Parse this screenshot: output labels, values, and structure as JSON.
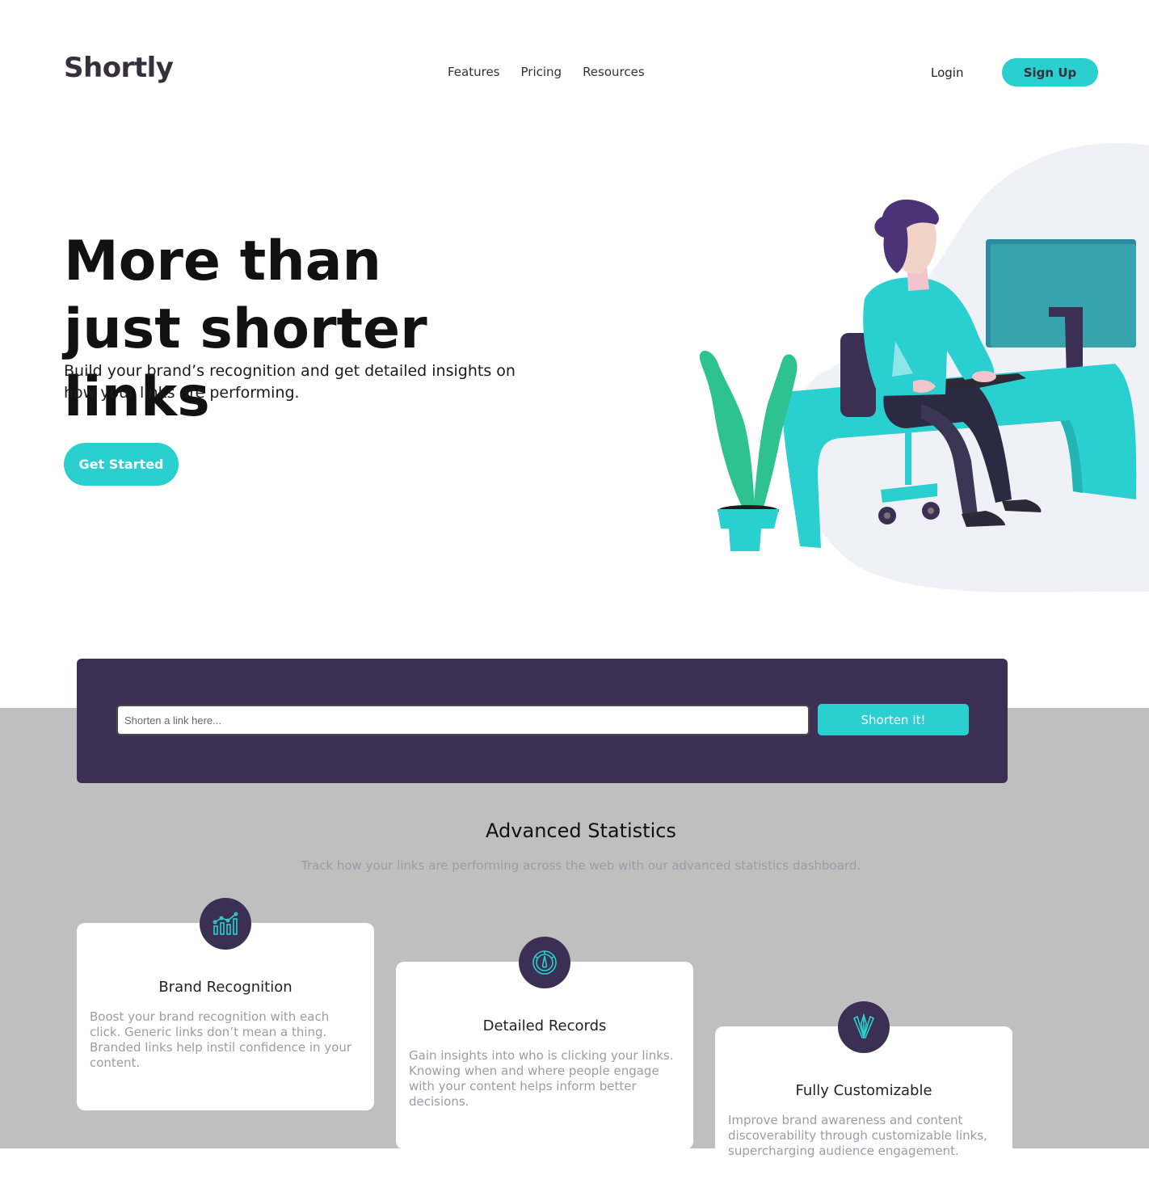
{
  "header": {
    "logo": "Shortly",
    "menu": [
      {
        "label": "Features"
      },
      {
        "label": "Pricing"
      },
      {
        "label": "Resources"
      }
    ],
    "login_label": "Login",
    "signup_label": "Sign Up"
  },
  "hero": {
    "title": "More than just shorter links",
    "subtitle": "Build your brand’s recognition and get detailed insights on how your links are performing.",
    "cta_label": "Get Started",
    "illustration_icon": "person-working-at-desk-illustration"
  },
  "shorten": {
    "placeholder": "Shorten a link here...",
    "button_label": "Shorten It!"
  },
  "stats": {
    "title": "Advanced Statistics",
    "subtitle": "Track how your links are performing across the web with our advanced statistics dashboard.",
    "cards": [
      {
        "icon": "bar-chart-icon",
        "title": "Brand Recognition",
        "text": "Boost your brand recognition with each click. Generic links don’t mean a thing. Branded links help instil confidence in your content."
      },
      {
        "icon": "speedometer-icon",
        "title": "Detailed Records",
        "text": "Gain insights into who is clicking your links. Knowing when and where people engage with your content helps inform better decisions."
      },
      {
        "icon": "design-tools-icon",
        "title": "Fully Customizable",
        "text": "Improve brand awareness and content discoverability through customizable links, supercharging audience engagement."
      }
    ]
  },
  "colors": {
    "primary_cyan": "#2acfcf",
    "dark_violet": "#3b3054",
    "grayish_violet": "#9e9aa7",
    "section_gray": "#bfbfbf"
  }
}
